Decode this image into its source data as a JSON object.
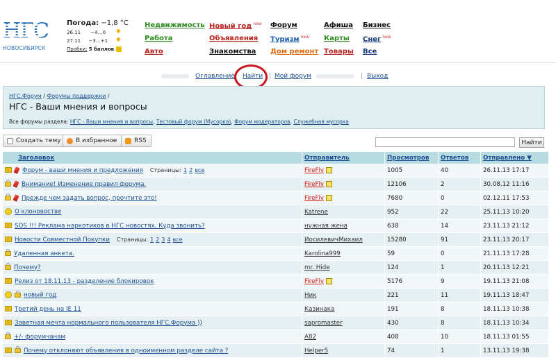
{
  "header": {
    "logo_text": "НГС",
    "city": "НОВОСИБИРСК",
    "weather_label": "Погода:",
    "weather_now": "−1,8 °C",
    "forecast": [
      {
        "date": "26.11",
        "temp": "−4…0"
      },
      {
        "date": "27.11",
        "temp": "−3…+1"
      }
    ],
    "traffic_label": "Пробки:",
    "traffic_value": "5 баллов"
  },
  "menu": {
    "col1": [
      "Недвижимость",
      "Работа",
      "Авто"
    ],
    "col2": [
      "Новый год",
      "Объявления",
      "Знакомства"
    ],
    "col2_badge": "new",
    "col3": [
      "Форум",
      "Туризм",
      "Дом ремонт"
    ],
    "col3_badge": "new",
    "col4": [
      "Афиша",
      "Карты",
      "Товары"
    ],
    "col5": [
      "Бизнес",
      "Снег",
      "Все"
    ],
    "col5_badge": "new"
  },
  "userbar": {
    "toc": "Оглавление",
    "find": "Найти",
    "my_forum": "Мой форум",
    "logout": "Выход"
  },
  "forum": {
    "crumbs": [
      "НГС.Форум",
      "Форумы поддержки"
    ],
    "crumb_sep": "/",
    "title": "НГС - Ваши мнения и вопросы",
    "all_label": "Все форумы раздела:",
    "all_links": [
      "НГС - Ваши мнения и вопросы",
      "Тестовый форум (Мусорка)",
      "Форум модераторов",
      "Служебная мусорка"
    ]
  },
  "toolbar": {
    "create": "Создать тему",
    "favorite": "В избранное",
    "rss": "RSS",
    "search_btn": "Найти",
    "search_value": ""
  },
  "table": {
    "headers": [
      "Заголовок",
      "Отправитель",
      "Просмотров",
      "Ответов",
      "Отправлено ▼"
    ],
    "pages_label": "Страницы:",
    "rows": [
      {
        "icon": "book",
        "pin": true,
        "title": "Форум - ваши мнения и предложения",
        "pages": [
          "1",
          "2",
          "все"
        ],
        "author": "FireFly",
        "author_red": true,
        "views": "1005",
        "replies": "40",
        "date": "26.11.13 17:17"
      },
      {
        "icon": "lock",
        "pin": true,
        "title": "Внимание! Изменение правил форума.",
        "pages": [],
        "author": "FireFly",
        "author_red": true,
        "views": "12106",
        "replies": "2",
        "date": "30.08.12 11:16"
      },
      {
        "icon": "lock",
        "pin": true,
        "title": "Прежде чем задать вопрос, прочтите это!",
        "pages": [],
        "author": "FireFly",
        "author_red": true,
        "views": "7680",
        "replies": "0",
        "date": "02.12.11 17:53"
      },
      {
        "icon": "smile",
        "pin": false,
        "title": "О клоновостве",
        "pages": [],
        "author": "Katrene",
        "author_red": false,
        "views": "952",
        "replies": "22",
        "date": "25.11.13 10:20"
      },
      {
        "icon": "book",
        "pin": false,
        "title": "SOS !!! Реклама наркотиков в НГС новостях. Куда звонить?",
        "pages": [],
        "author": "нужная жена",
        "author_red": false,
        "views": "638",
        "replies": "14",
        "date": "23.11.13 21:12"
      },
      {
        "icon": "book",
        "pin": false,
        "title": "Новости Совместной Покупки",
        "pages": [
          "1",
          "2",
          "3",
          "4",
          "все"
        ],
        "author": "ИосилевичМихаил",
        "author_red": false,
        "views": "15280",
        "replies": "91",
        "date": "23.11.13 20:17"
      },
      {
        "icon": "lock",
        "pin": false,
        "title": "Удаленная анкета.",
        "pages": [],
        "author": "Karolina999",
        "author_red": false,
        "views": "59",
        "replies": "0",
        "date": "21.11.13 17:28"
      },
      {
        "icon": "lock",
        "pin": false,
        "title": "Почему?",
        "pages": [],
        "author": "mr. Hide",
        "author_red": false,
        "views": "124",
        "replies": "1",
        "date": "20.11.13 12:21"
      },
      {
        "icon": "book",
        "pin": false,
        "title": "Релиз от 18.11.13 - разделение блокировок",
        "pages": [],
        "author": "FireFly",
        "author_red": true,
        "views": "5176",
        "replies": "9",
        "date": "19.11.13 21:08"
      },
      {
        "icon": "smile-lock",
        "pin": false,
        "title": "новый год",
        "pages": [],
        "author": "Ник",
        "author_red": false,
        "views": "221",
        "replies": "11",
        "date": "19.11.13 18:47"
      },
      {
        "icon": "book",
        "pin": false,
        "title": "Третий день на IE 11",
        "pages": [],
        "author": "Казинака",
        "author_red": false,
        "views": "191",
        "replies": "8",
        "date": "18.11.13 10:38"
      },
      {
        "icon": "book",
        "pin": false,
        "title": "Заветная мечта нормального пользователя НГС.Форума ))",
        "pages": [],
        "author": "sapromaster",
        "author_red": false,
        "views": "430",
        "replies": "8",
        "date": "18.11.13 10:34"
      },
      {
        "icon": "lock",
        "pin": false,
        "title": "+/- форумчанам",
        "pages": [],
        "author": "A82",
        "author_red": false,
        "views": "408",
        "replies": "10",
        "date": "18.11.13 01:55"
      },
      {
        "icon": "book-lock",
        "pin": false,
        "title": "Почему отклоняют объявления в одноименном разделе сайта ?",
        "pages": [],
        "author": "Helper5",
        "author_red": false,
        "views": "74",
        "replies": "1",
        "date": "13.11.13 19:38"
      }
    ]
  }
}
